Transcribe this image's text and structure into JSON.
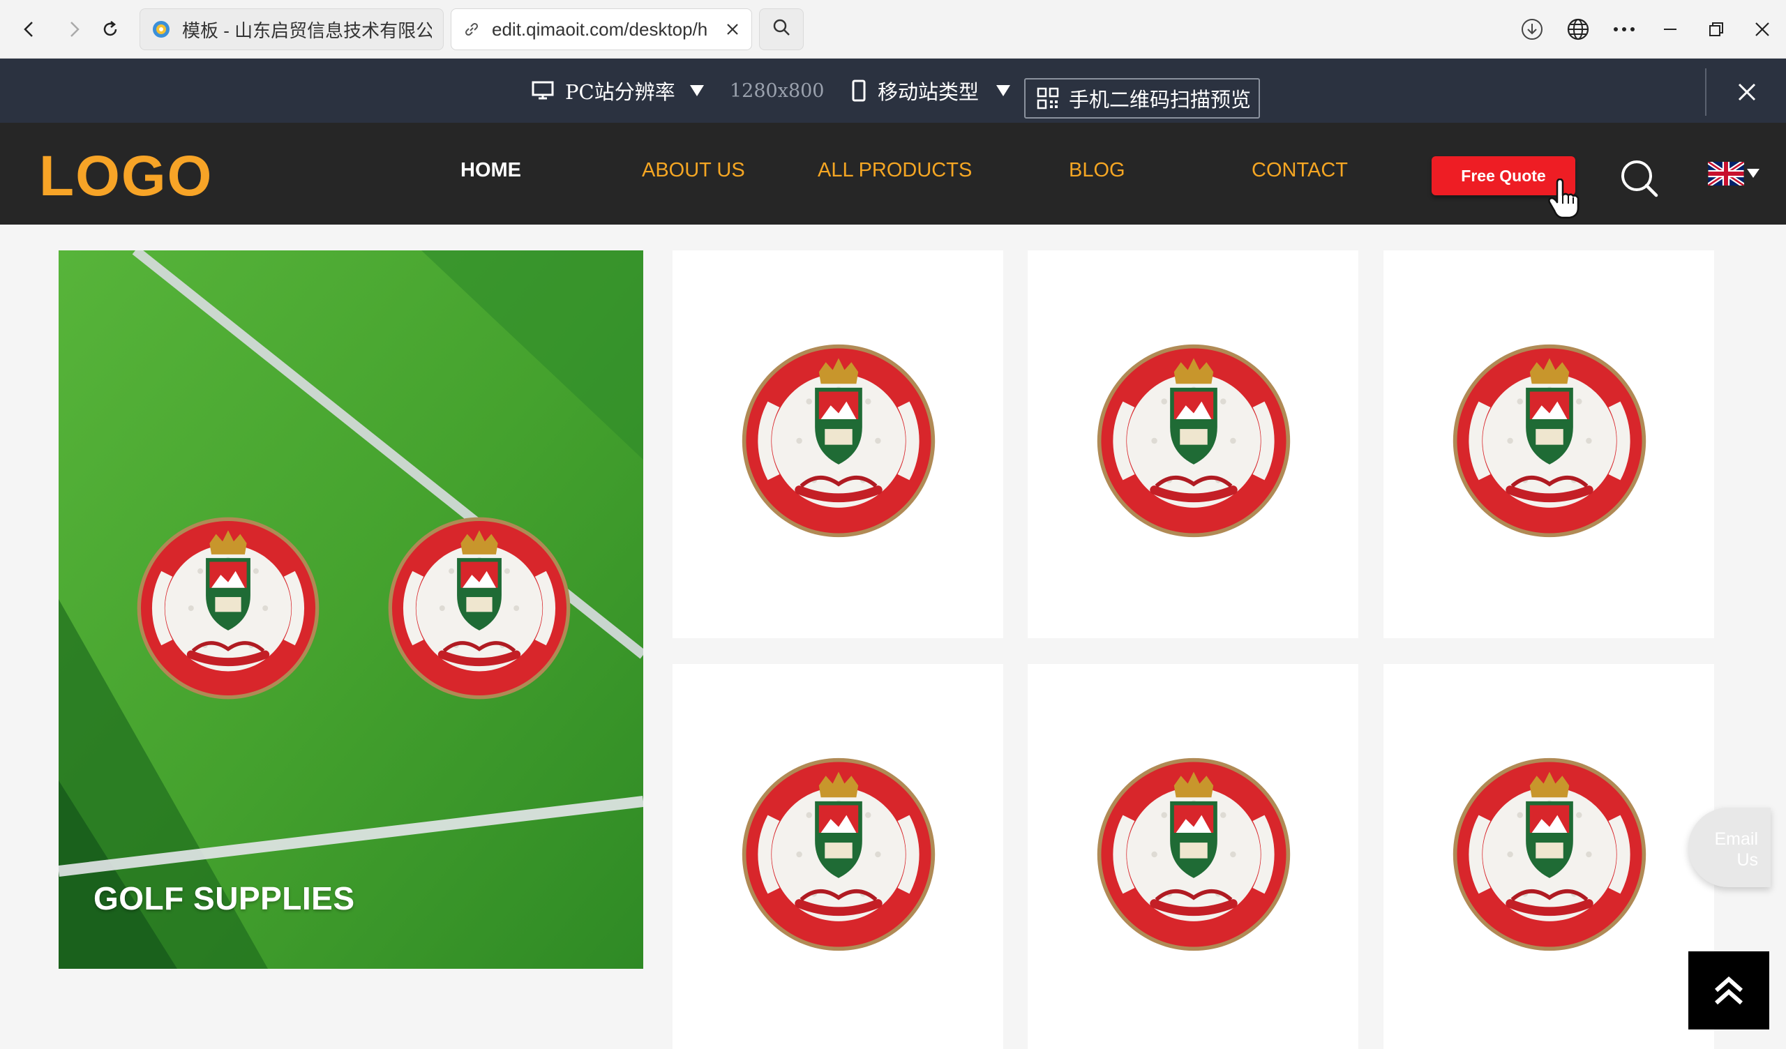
{
  "browser": {
    "tabs": [
      {
        "title": "模板 - 山东启贸信息技术有限公司"
      },
      {
        "title": "edit.qimaoit.com/desktop/h"
      }
    ]
  },
  "editor_bar": {
    "pc_label": "PC站分辨率",
    "resolution": "1280x800",
    "mobile_label": "移动站类型",
    "qr_label": "手机二维码扫描预览"
  },
  "site": {
    "logo": "LOGO",
    "nav": [
      "HOME",
      "ABOUT US",
      "ALL PRODUCTS",
      "BLOG",
      "CONTACT"
    ],
    "active_nav": "HOME",
    "quote_button": "Free Quote"
  },
  "feature": {
    "title": "GOLF SUPPLIES"
  },
  "product_cards": 6,
  "floating": {
    "email_line1": "Email",
    "email_line2": "Us"
  },
  "colors": {
    "accent": "#f5a623",
    "quote": "#ee1d24",
    "header_bg": "#262626",
    "toolbar_bg": "#2b3240"
  }
}
